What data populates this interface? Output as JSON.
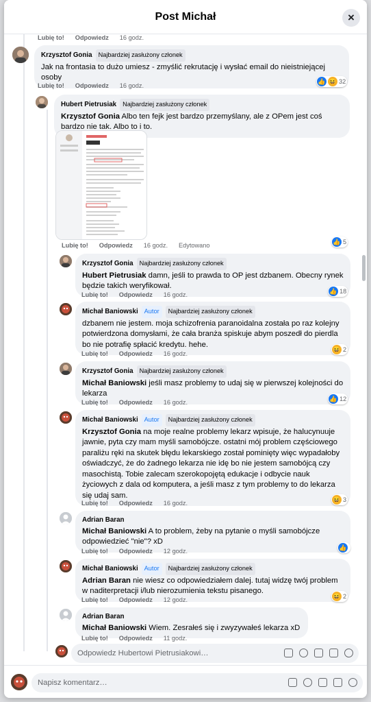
{
  "header": {
    "title": "Post Michał",
    "close_icon": "×"
  },
  "labels": {
    "like": "Lubię to!",
    "reply": "Odpowiedz",
    "edited": "Edytowano",
    "badge_top": "Najbardziej zasłużony członek",
    "badge_author": "Autor"
  },
  "top_actions": {
    "time": "16 godz."
  },
  "comments": [
    {
      "author": "Krzysztof Gonia",
      "text": "Jak na frontasia to dużo umiesz - zmyślić rekrutację i wysłać email do nieistniejącej osoby",
      "time": "16 godz.",
      "reactions": "32"
    },
    {
      "author": "Hubert Pietrusiak",
      "mention": "Krzysztof Gonia",
      "text": " Albo ten fejk jest bardzo przemyślany, ale z OPem jest coś bardzo nie tak. Albo to i to.",
      "time": "16 godz.",
      "reactions": "5"
    },
    {
      "author": "Krzysztof Gonia",
      "mention": "Hubert Pietrusiak",
      "text": " damn, jeśli to prawda to OP jest dzbanem. Obecny rynek będzie takich weryfikował.",
      "time": "16 godz.",
      "reactions": "18"
    },
    {
      "author": "Michał Baniowski",
      "text": "dzbanem nie jestem. moja schizofrenia paranoidalna została po raz kolejny potwierdzona domysłami, że cała branża spiskuje abym poszedł do pierdla bo nie potrafię spłacić kredytu. hehe.",
      "time": "16 godz.",
      "reactions": "2"
    },
    {
      "author": "Krzysztof Gonia",
      "mention": "Michał Baniowski",
      "text": " jeśli masz problemy to udaj się w pierwszej kolejności do lekarza",
      "time": "16 godz.",
      "reactions": "12"
    },
    {
      "author": "Michał Baniowski",
      "mention": "Krzysztof Gonia",
      "text": " na moje realne problemy lekarz wpisuje, że halucynuuje jawnie, pyta czy mam myśli samobójcze. ostatni mój problem częściowego paraliżu ręki na skutek błędu lekarskiego został pominięty więc wypadałoby oświadczyć, że do żadnego lekarza nie idę bo nie jestem samobójcą czy masochistą. Tobie zalecam szerokopojętą edukacje i odbycie nauk życiowych z dala od komputera, a jeśli masz z tym problemy to do lekarza się udaj sam.",
      "time": "16 godz.",
      "reactions": "3"
    },
    {
      "author": "Adrian Baran",
      "mention": "Michał Baniowski",
      "text": " A to problem, żeby na pytanie o myśli samobójcze odpowiedzieć \"nie\"? xD",
      "time": "12 godz.",
      "reactions": ""
    },
    {
      "author": "Michał Baniowski",
      "mention": "Adrian Baran",
      "text": " nie wiesz co odpowiedziałem dalej. tutaj widzę twój problem w naditerpretacji i/lub nierozumienia tekstu pisanego.",
      "time": "12 godz.",
      "reactions": "2"
    },
    {
      "author": "Adrian Baran",
      "mention": "Michał Baniowski",
      "text": " Wiem. Zesrałeś się i zwyzywałeś lekarza xD",
      "time": "11 godz.",
      "reactions": ""
    }
  ],
  "reply_box": {
    "placeholder": "Odpowiedz Hubertowi Pietrusiakowi…"
  },
  "footer": {
    "placeholder": "Napisz komentarz…"
  },
  "icons": [
    "close-icon",
    "like-icon",
    "haha-icon",
    "sticker-icon",
    "emoji-icon",
    "camera-icon",
    "gif-icon",
    "avatar-sticker-icon"
  ],
  "colors": {
    "like": "#1877f2",
    "haha": "#f7b125",
    "bubble": "#f0f2f5",
    "meta": "#65676b"
  }
}
